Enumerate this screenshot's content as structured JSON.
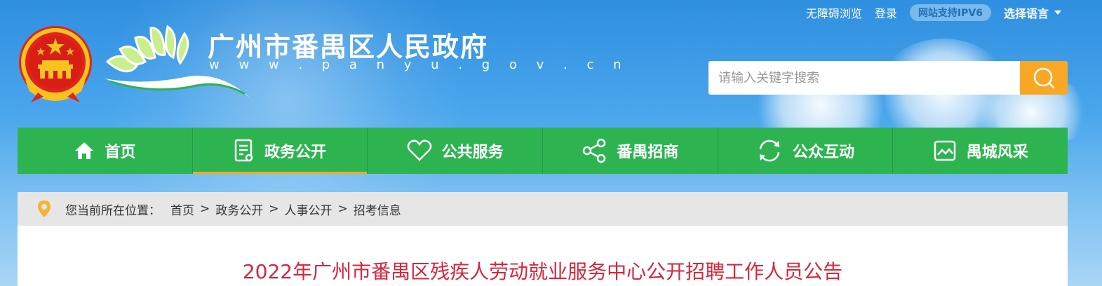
{
  "topbar": {
    "accessibility": "无障碍浏览",
    "login": "登录",
    "ipv6_badge": "网站支持IPV6",
    "language": "选择语言"
  },
  "header": {
    "site_title": "广州市番禺区人民政府",
    "site_url": "w w w . p a n y u . g o v . c n"
  },
  "search": {
    "placeholder": "请输入关键字搜索",
    "button_icon": "search-icon"
  },
  "nav": {
    "items": [
      {
        "label": "首页",
        "icon": "home-icon"
      },
      {
        "label": "政务公开",
        "icon": "document-icon"
      },
      {
        "label": "公共服务",
        "icon": "heart-icon"
      },
      {
        "label": "番禺招商",
        "icon": "share-icon"
      },
      {
        "label": "公众互动",
        "icon": "refresh-icon"
      },
      {
        "label": "禺城风采",
        "icon": "image-icon"
      }
    ],
    "active_index": 1
  },
  "breadcrumb": {
    "prefix": "您当前所在位置：",
    "items": [
      "首页",
      "政务公开",
      "人事公开",
      "招考信息"
    ],
    "separator": ">"
  },
  "article": {
    "title": "2022年广州市番禺区残疾人劳动就业服务中心公开招聘工作人员公告"
  },
  "colors": {
    "nav_green": "#2eb351",
    "accent_orange": "#f9a825",
    "title_red": "#d7263d"
  }
}
